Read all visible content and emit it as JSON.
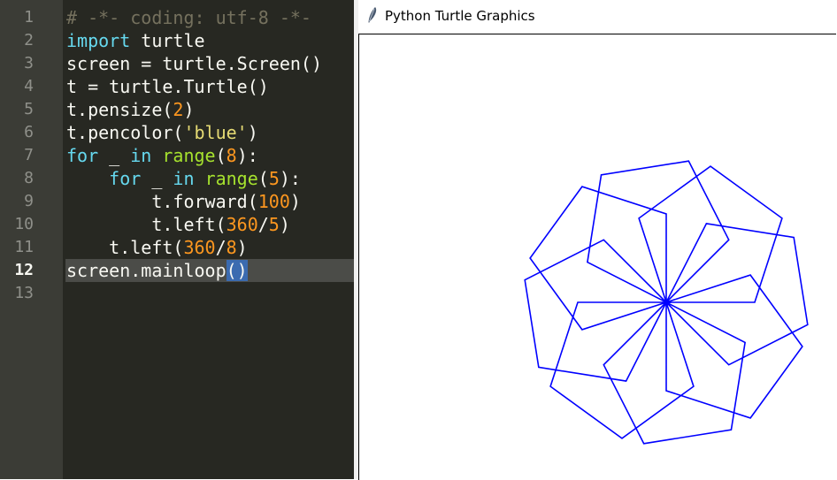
{
  "editor": {
    "active_line": 12,
    "line_numbers": [
      "1",
      "2",
      "3",
      "4",
      "5",
      "6",
      "7",
      "8",
      "9",
      "10",
      "11",
      "12",
      "13"
    ],
    "lines": [
      [
        {
          "t": "# -*- coding: utf-8 -*-",
          "c": "cm"
        }
      ],
      [
        {
          "t": "import",
          "c": "kw"
        },
        {
          "t": " turtle",
          "c": ""
        }
      ],
      [
        {
          "t": "screen = turtle.Screen()",
          "c": ""
        }
      ],
      [
        {
          "t": "t = turtle.Turtle()",
          "c": ""
        }
      ],
      [
        {
          "t": "t.pensize(",
          "c": ""
        },
        {
          "t": "2",
          "c": "num"
        },
        {
          "t": ")",
          "c": ""
        }
      ],
      [
        {
          "t": "t.pencolor(",
          "c": ""
        },
        {
          "t": "'blue'",
          "c": "str"
        },
        {
          "t": ")",
          "c": ""
        }
      ],
      [
        {
          "t": "for",
          "c": "kw"
        },
        {
          "t": " _ ",
          "c": ""
        },
        {
          "t": "in",
          "c": "kw"
        },
        {
          "t": " ",
          "c": ""
        },
        {
          "t": "range",
          "c": "bi"
        },
        {
          "t": "(",
          "c": ""
        },
        {
          "t": "8",
          "c": "num"
        },
        {
          "t": "):",
          "c": ""
        }
      ],
      [
        {
          "t": "    ",
          "c": ""
        },
        {
          "t": "for",
          "c": "kw"
        },
        {
          "t": " _ ",
          "c": ""
        },
        {
          "t": "in",
          "c": "kw"
        },
        {
          "t": " ",
          "c": ""
        },
        {
          "t": "range",
          "c": "bi"
        },
        {
          "t": "(",
          "c": ""
        },
        {
          "t": "5",
          "c": "num"
        },
        {
          "t": "):",
          "c": ""
        }
      ],
      [
        {
          "t": "        t.forward(",
          "c": ""
        },
        {
          "t": "100",
          "c": "num"
        },
        {
          "t": ")",
          "c": ""
        }
      ],
      [
        {
          "t": "        t.left(",
          "c": ""
        },
        {
          "t": "360",
          "c": "num"
        },
        {
          "t": "/",
          "c": ""
        },
        {
          "t": "5",
          "c": "num"
        },
        {
          "t": ")",
          "c": ""
        }
      ],
      [
        {
          "t": "    t.left(",
          "c": ""
        },
        {
          "t": "360",
          "c": "num"
        },
        {
          "t": "/",
          "c": ""
        },
        {
          "t": "8",
          "c": "num"
        },
        {
          "t": ")",
          "c": ""
        }
      ],
      [
        {
          "t": "screen.mainloop",
          "c": ""
        },
        {
          "t": "()",
          "c": "sel"
        }
      ],
      []
    ]
  },
  "turtle_window": {
    "title": "Python Turtle Graphics",
    "icon": "feather-icon",
    "drawing": {
      "pen_color": "#0000ff",
      "pen_size": 2,
      "outer_repeats": 8,
      "inner_repeats": 5,
      "forward": 100,
      "inner_turn_deg": 72,
      "outer_turn_deg": 45
    }
  },
  "colors": {
    "editor_bg": "#272822",
    "gutter_bg": "#3b3c36",
    "comment": "#75715e",
    "keyword": "#66d9ef",
    "builtin": "#a6e22e",
    "number": "#fd971f",
    "string": "#e6db74",
    "selection": "#3b6bb0"
  }
}
